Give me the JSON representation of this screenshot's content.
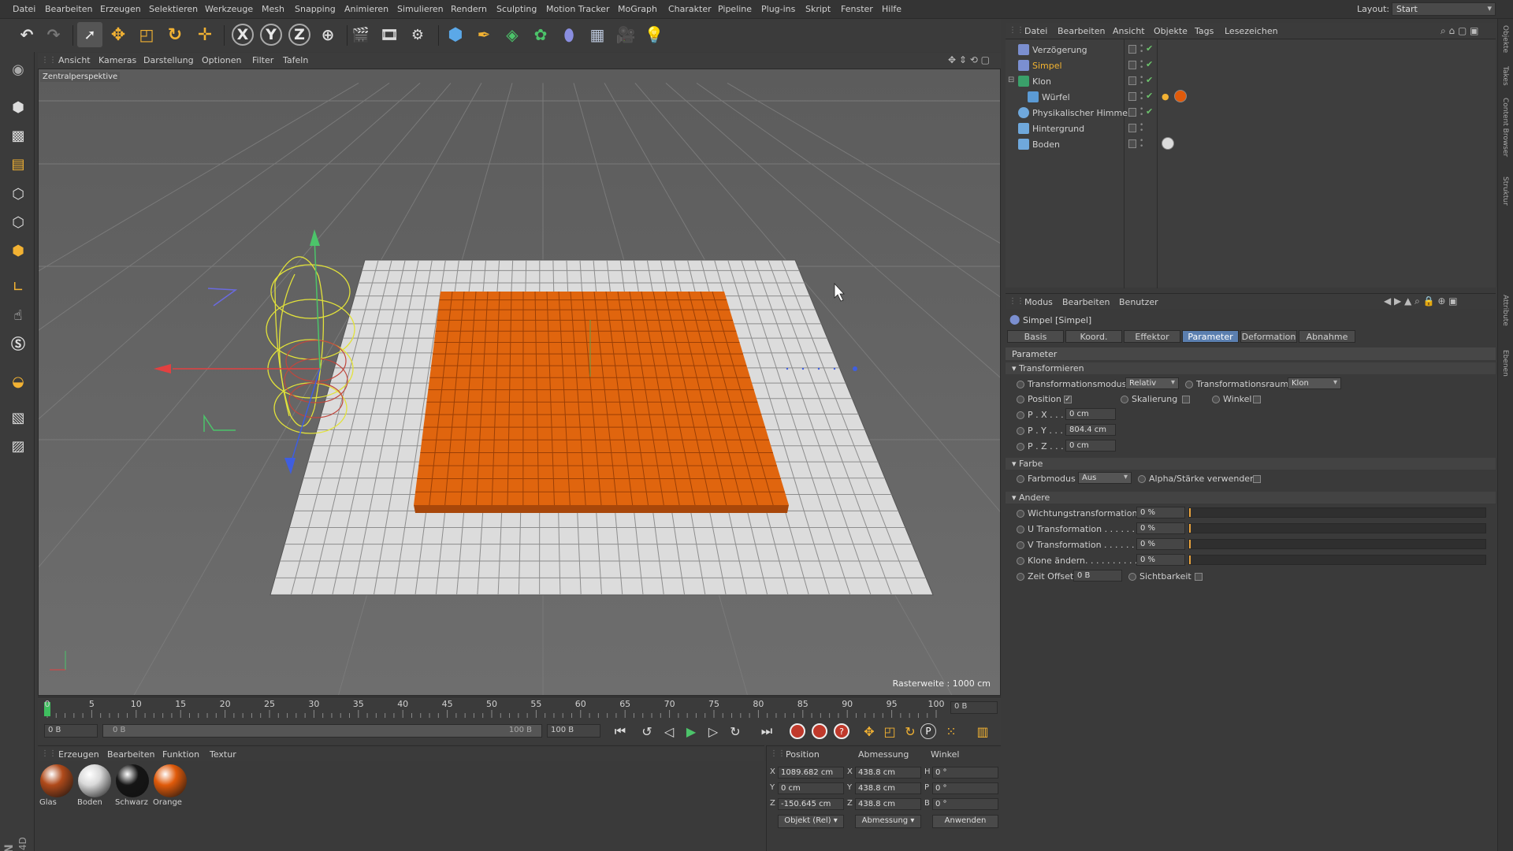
{
  "menu": [
    "Datei",
    "Bearbeiten",
    "Erzeugen",
    "Selektieren",
    "Werkzeuge",
    "Mesh",
    "Snapping",
    "Animieren",
    "Simulieren",
    "Rendern",
    "Sculpting",
    "Motion Tracker",
    "MoGraph",
    "Charakter",
    "Pipeline",
    "Plug-ins",
    "Skript",
    "Fenster",
    "Hilfe"
  ],
  "layout": {
    "label": "Layout:",
    "value": "Start"
  },
  "toolbar": {
    "axis_x": "X",
    "axis_y": "Y",
    "axis_z": "Z"
  },
  "viewport": {
    "menu": [
      "Ansicht",
      "Kameras",
      "Darstellung",
      "Optionen",
      "Filter",
      "Tafeln"
    ],
    "camera_label": "Zentralperspektive",
    "grid_label": "Rasterweite : 1000 cm"
  },
  "timeline": {
    "ticks": [
      "0",
      "5",
      "10",
      "15",
      "20",
      "25",
      "30",
      "35",
      "40",
      "45",
      "50",
      "55",
      "60",
      "65",
      "70",
      "75",
      "80",
      "85",
      "90",
      "95",
      "100"
    ],
    "frame_field": "0 B",
    "start": "0 B",
    "range_left": "0 B",
    "range_right": "100 B",
    "end": "100 B"
  },
  "materials": {
    "menu": [
      "Erzeugen",
      "Bearbeiten",
      "Funktion",
      "Textur"
    ],
    "items": [
      {
        "label": "Glas",
        "color": "#b04a1a"
      },
      {
        "label": "Boden",
        "color": "#d9d9d9"
      },
      {
        "label": "Schwarz",
        "color": "#151515"
      },
      {
        "label": "Orange",
        "color": "#e05a0a"
      }
    ]
  },
  "coords": {
    "headers": [
      "Position",
      "Abmessung",
      "Winkel"
    ],
    "rows": [
      {
        "a": "X",
        "pos": "1089.682 cm",
        "b": "X",
        "size": "438.8 cm",
        "c": "H",
        "ang": "0 °"
      },
      {
        "a": "Y",
        "pos": "0 cm",
        "b": "Y",
        "size": "438.8 cm",
        "c": "P",
        "ang": "0 °"
      },
      {
        "a": "Z",
        "pos": "-150.645 cm",
        "b": "Z",
        "size": "438.8 cm",
        "c": "B",
        "ang": "0 °"
      }
    ],
    "mode": "Objekt (Rel)",
    "size_mode": "Abmessung",
    "apply": "Anwenden"
  },
  "object_manager": {
    "menu": [
      "Datei",
      "Bearbeiten",
      "Ansicht",
      "Objekte",
      "Tags",
      "Lesezeichen"
    ],
    "objects": [
      {
        "name": "Verzögerung",
        "indent": 0,
        "active": false,
        "icon_color": "#7b8fd0"
      },
      {
        "name": "Simpel",
        "indent": 0,
        "active": true,
        "icon_color": "#7b8fd0"
      },
      {
        "name": "Klon",
        "indent": 0,
        "active": false,
        "icon_color": "#3aa06a"
      },
      {
        "name": "Würfel",
        "indent": 1,
        "active": false,
        "icon_color": "#5b9bd5"
      },
      {
        "name": "Physikalischer Himmel",
        "indent": 0,
        "active": false,
        "icon_color": "#6fa8dc"
      },
      {
        "name": "Hintergrund",
        "indent": 0,
        "active": false,
        "icon_color": "#6fa8dc"
      },
      {
        "name": "Boden",
        "indent": 0,
        "active": false,
        "icon_color": "#6fa8dc"
      }
    ]
  },
  "attribute_manager": {
    "menu": [
      "Modus",
      "Bearbeiten",
      "Benutzer"
    ],
    "title": "Simpel [Simpel]",
    "tabs": [
      "Basis",
      "Koord.",
      "Effektor",
      "Parameter",
      "Deformation",
      "Abnahme"
    ],
    "active_tab": "Parameter",
    "section": "Parameter",
    "transform": {
      "heading": "Transformieren",
      "mode_label": "Transformationsmodus",
      "mode_value": "Relativ",
      "space_label": "Transformationsraum",
      "space_value": "Klon",
      "position_label": "Position",
      "scale_label": "Skalierung",
      "angle_label": "Winkel",
      "px_label": "P . X . . .",
      "px": "0 cm",
      "py_label": "P . Y . . .",
      "py": "804.4 cm",
      "pz_label": "P . Z . . .",
      "pz": "0 cm"
    },
    "color": {
      "heading": "Farbe",
      "mode_label": "Farbmodus",
      "mode_value": "Aus",
      "alpha_label": "Alpha/Stärke verwenden"
    },
    "other": {
      "heading": "Andere",
      "weight_label": "Wichtungstransformation",
      "weight": "0 %",
      "u_label": "U Transformation . . . . . . .",
      "u": "0 %",
      "v_label": "V Transformation . . . . . . .",
      "v": "0 %",
      "clone_label": "Klone ändern. . . . . . . . . .",
      "clone": "0 %",
      "time_label": "Zeit Offset",
      "time": "0 B",
      "vis_label": "Sichtbarkeit"
    }
  },
  "right_tabs": [
    "Objekte",
    "Takes",
    "Content Browser",
    "Struktur",
    "Attribute",
    "Ebenen"
  ]
}
